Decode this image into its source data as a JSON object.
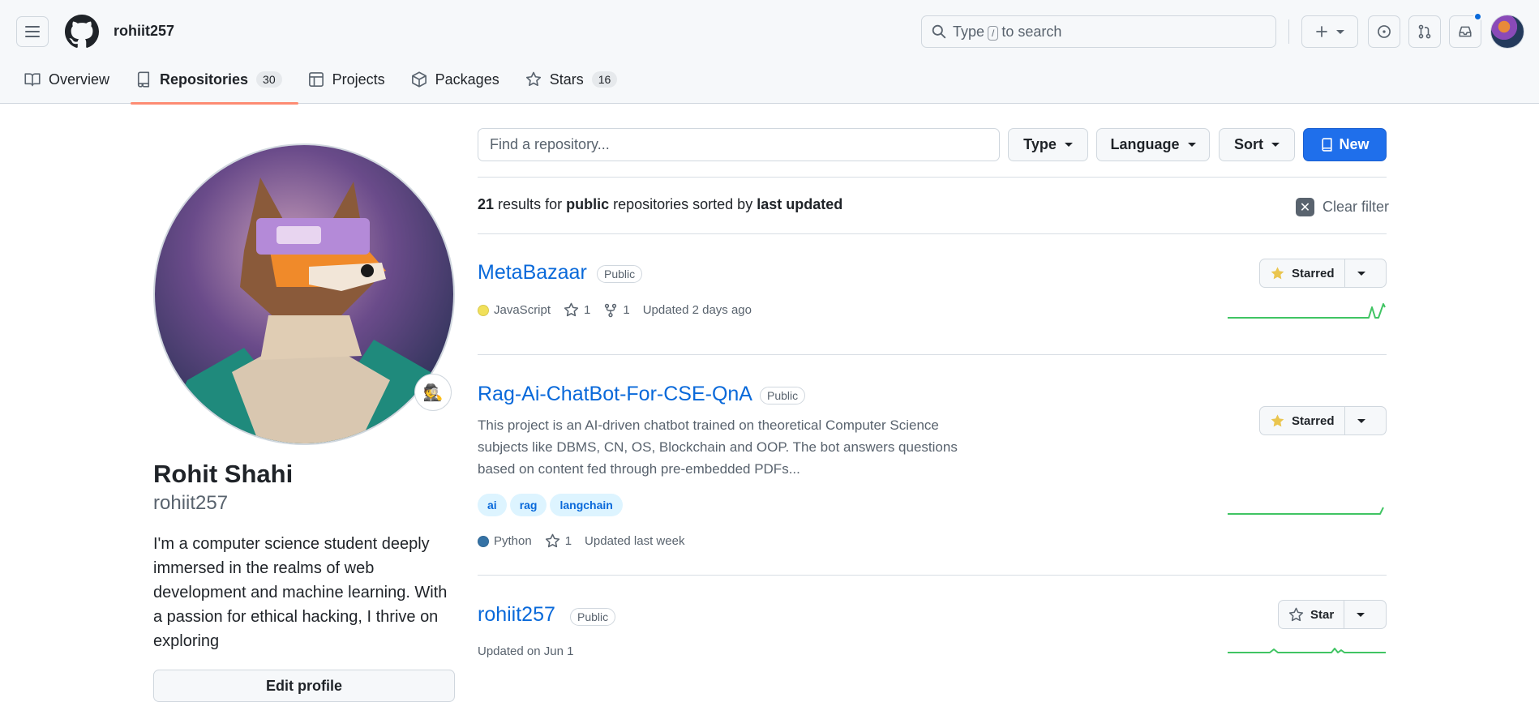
{
  "header": {
    "username": "rohiit257",
    "search_prefix": "Type",
    "search_key": "/",
    "search_suffix": "to search"
  },
  "tabs": [
    {
      "label": "Overview",
      "count": ""
    },
    {
      "label": "Repositories",
      "count": "30"
    },
    {
      "label": "Projects",
      "count": ""
    },
    {
      "label": "Packages",
      "count": ""
    },
    {
      "label": "Stars",
      "count": "16"
    }
  ],
  "profile": {
    "name": "Rohit Shahi",
    "login": "rohiit257",
    "bio": "I'm a computer science student deeply immersed in the realms of web development and machine learning. With a passion for ethical hacking, I thrive on exploring",
    "edit_label": "Edit profile",
    "status_emoji": "🕵️"
  },
  "filters": {
    "find_placeholder": "Find a repository...",
    "type_label": "Type",
    "language_label": "Language",
    "sort_label": "Sort",
    "new_label": "New"
  },
  "results": {
    "count": "21",
    "mid1": "results for",
    "visibility": "public",
    "mid2": "repositories sorted by",
    "sort": "last updated",
    "clear_label": "Clear filter"
  },
  "repos": [
    {
      "name": "MetaBazaar",
      "visibility": "Public",
      "language": "JavaScript",
      "language_color": "#f1e05a",
      "stars": "1",
      "forks": "1",
      "updated": "Updated 2 days ago",
      "star_label": "Starred"
    },
    {
      "name": "Rag-Ai-ChatBot-For-CSE-QnA",
      "visibility": "Public",
      "description": "This project is an AI-driven chatbot trained on theoretical Computer Science subjects like DBMS, CN, OS, Blockchain and OOP. The bot answers questions based on content fed through pre-embedded PDFs...",
      "topics": [
        "ai",
        "rag",
        "langchain"
      ],
      "language": "Python",
      "language_color": "#3572A5",
      "stars": "1",
      "updated": "Updated last week",
      "star_label": "Starred"
    },
    {
      "name": "rohiit257",
      "visibility": "Public",
      "updated": "Updated on Jun 1",
      "star_label": "Star"
    }
  ],
  "colors": {
    "accent": "#0969da",
    "primary_button": "#1f6feb",
    "tab_underline": "#fd8c73",
    "starred": "#eac54f",
    "sparkline": "#40c463"
  }
}
